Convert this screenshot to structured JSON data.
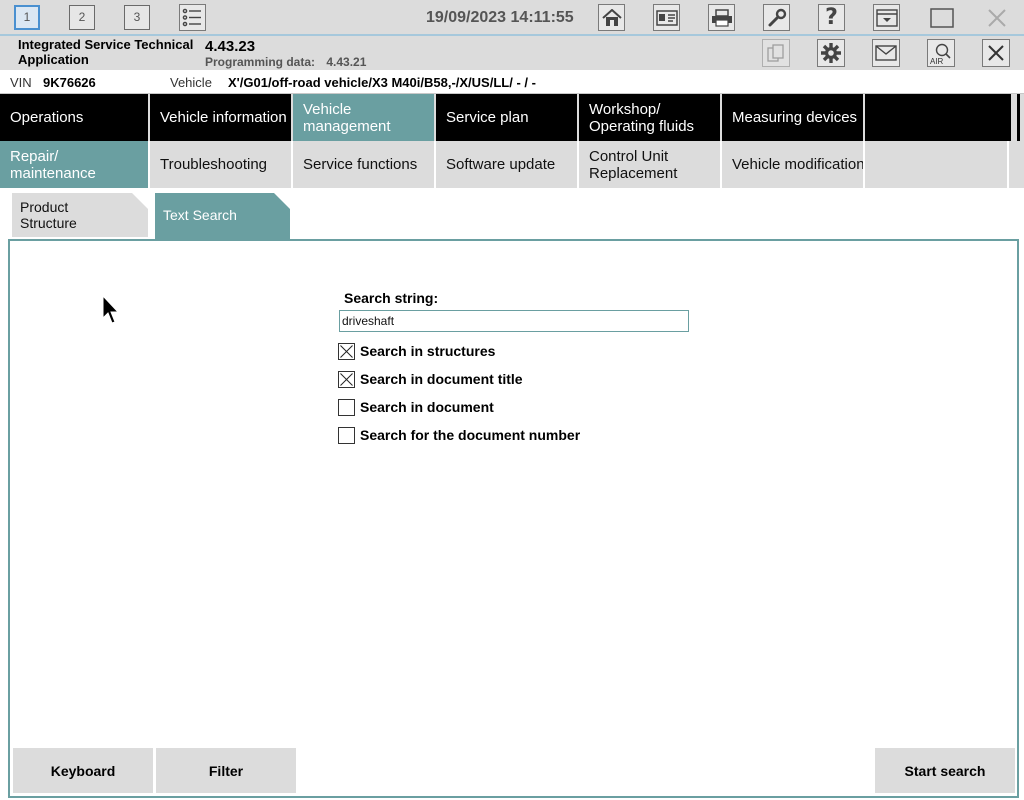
{
  "sessions": [
    "1",
    "2",
    "3"
  ],
  "datetime": "19/09/2023 14:11:55",
  "app": {
    "name": "Integrated Service Technical Application",
    "version": "4.43.23",
    "programming_label": "Programming data:",
    "programming_value": "4.43.21"
  },
  "vehicle_row": {
    "vin_label": "VIN",
    "vin_value": "9K76626",
    "vehicle_label": "Vehicle",
    "vehicle_value": "X'/G01/off-road vehicle/X3 M40i/B58,-/X/US/LL/ - / -"
  },
  "main_nav": [
    {
      "label": "Operations"
    },
    {
      "label": "Vehicle information"
    },
    {
      "label": "Vehicle management"
    },
    {
      "label": "Service plan"
    },
    {
      "label": "Workshop/ Operating fluids"
    },
    {
      "label": "Measuring devices"
    }
  ],
  "sub_nav": [
    {
      "label": "Repair/ maintenance"
    },
    {
      "label": "Troubleshooting"
    },
    {
      "label": "Service functions"
    },
    {
      "label": "Software update"
    },
    {
      "label": "Control Unit Replacement"
    },
    {
      "label": "Vehicle modification"
    }
  ],
  "tabs": [
    {
      "label": "Product Structure"
    },
    {
      "label": "Text Search"
    }
  ],
  "search": {
    "label": "Search string:",
    "value": "driveshaft",
    "options": [
      {
        "label": "Search in structures",
        "checked": true
      },
      {
        "label": "Search in document title",
        "checked": true
      },
      {
        "label": "Search in document",
        "checked": false
      },
      {
        "label": "Search for the document number",
        "checked": false
      }
    ]
  },
  "footer": {
    "keyboard_label": "Keyboard",
    "filter_label": "Filter",
    "start_label": "Start search"
  },
  "icons": {
    "toolbar": [
      "menu-list-icon",
      "home-icon",
      "id-card-icon",
      "print-icon",
      "wrench-icon",
      "help-icon",
      "download-icon",
      "window-maximize-icon",
      "close-icon"
    ],
    "header": [
      "copy-documents-icon",
      "gear-icon",
      "mail-icon",
      "air-icon",
      "close-icon"
    ]
  },
  "colors": {
    "accent": "#6a9fa1",
    "nav_background": "#000000",
    "panel_gray": "#dcdcdc"
  }
}
